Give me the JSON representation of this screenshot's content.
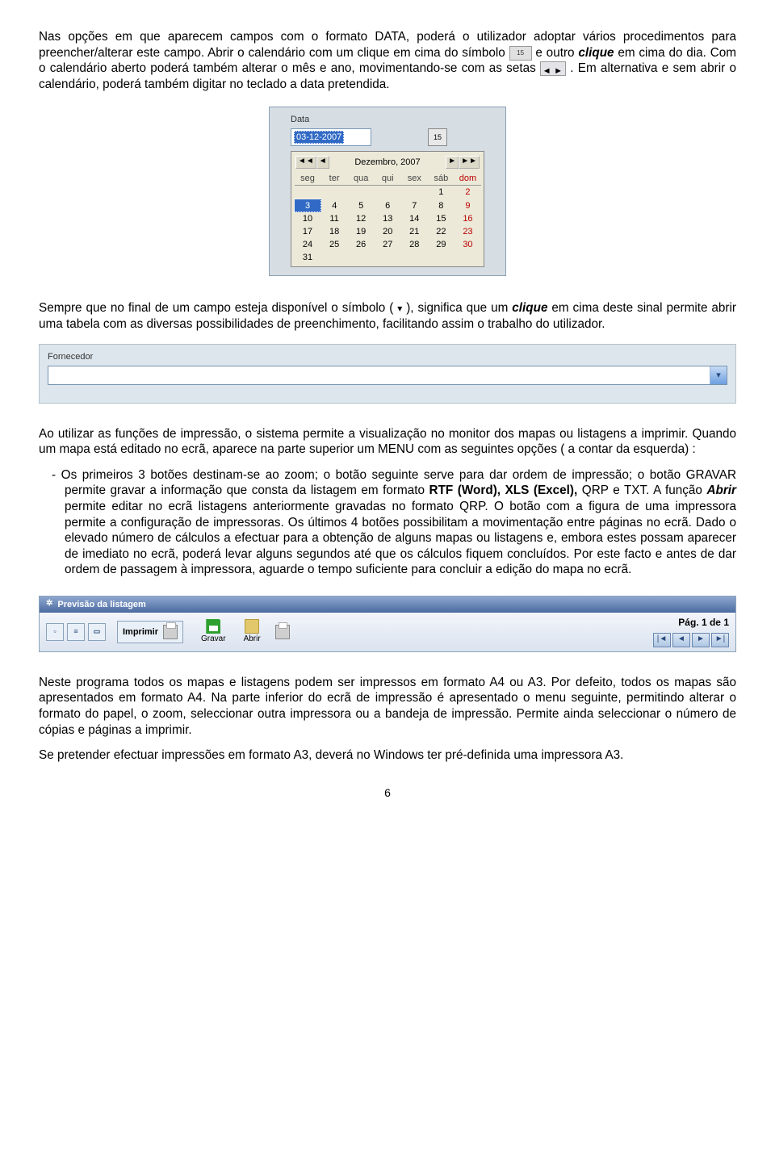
{
  "para1": {
    "t1": "Nas opções em que aparecem campos com o formato DATA, poderá o utilizador adoptar vários procedimentos para preencher/alterar este campo. Abrir o calendário com um clique em cima do símbolo ",
    "icon1_label": "15",
    "t2": " e outro ",
    "clique": "clique",
    "t3": " em cima do dia. Com o calendário aberto poderá também alterar o mês e ano, movimentando-se com as setas ",
    "t4": ". Em alternativa e sem abrir o calendário, poderá também digitar no teclado a data pretendida."
  },
  "calendar": {
    "label": "Data",
    "value": "03-12-2007",
    "popup_title": "Dezembro, 2007",
    "nav_prev2": "◄◄",
    "nav_prev1": "◄",
    "nav_next1": "►",
    "nav_next2": "►►",
    "dow": [
      "seg",
      "ter",
      "qua",
      "qui",
      "sex",
      "sáb",
      "dom"
    ],
    "cells": [
      [
        "",
        "",
        "",
        "",
        "",
        "1",
        "2"
      ],
      [
        "3",
        "4",
        "5",
        "6",
        "7",
        "8",
        "9"
      ],
      [
        "10",
        "11",
        "12",
        "13",
        "14",
        "15",
        "16"
      ],
      [
        "17",
        "18",
        "19",
        "20",
        "21",
        "22",
        "23"
      ],
      [
        "24",
        "25",
        "26",
        "27",
        "28",
        "29",
        "30"
      ],
      [
        "31",
        "",
        "",
        "",
        "",
        "",
        ""
      ]
    ],
    "selected": "3"
  },
  "para2": {
    "t1": "Sempre que no final de um campo esteja disponível o símbolo (",
    "t2": " ), significa que um ",
    "clique": "clique",
    "t3": " em cima deste sinal permite abrir uma tabela com as diversas possibilidades de preenchimento, facilitando assim o trabalho do utilizador."
  },
  "fornecedor": {
    "label": "Fornecedor"
  },
  "para3a": "Ao utilizar as funções de impressão, o sistema permite a visualização no monitor dos mapas ou listagens a imprimir. Quando um mapa está editado no ecrã, aparece na parte superior um MENU com as seguintes opções ( a contar da esquerda) :",
  "bullet": {
    "t1": "Os primeiros 3 botões destinam-se ao zoom; o botão seguinte serve para dar ordem de impressão; o botão GRAVAR permite gravar a informação que consta da listagem em formato ",
    "b1": "RTF (Word), XLS (Excel),",
    "t2": " QRP e TXT. A função ",
    "b2": "Abrir",
    "t3": " permite editar no ecrã listagens anteriormente gravadas no formato QRP. O botão com a figura de uma impressora permite a configuração de impressoras. Os últimos 4 botões possibilitam a movimentação entre páginas no ecrã. Dado o elevado número de cálculos a efectuar para a obtenção de alguns mapas ou listagens e, embora estes possam aparecer de imediato no ecrã, poderá levar alguns segundos até que os cálculos fiquem concluídos. Por este facto e antes de dar ordem de passagem à impressora, aguarde o tempo suficiente para concluir a edição do mapa no ecrã."
  },
  "toolbar": {
    "title": "Previsão da listagem",
    "zoom_whole": "▫",
    "zoom_width": "≡",
    "zoom_100": "▭",
    "print": "Imprimir",
    "save": "Gravar",
    "open": "Abrir",
    "pager": "Pág. 1 de 1",
    "nav_first": "|◄",
    "nav_prev": "◄",
    "nav_next": "►",
    "nav_last": "►|"
  },
  "para4a": "Neste programa todos os mapas e listagens podem ser impressos em formato A4 ou A3. Por defeito, todos os mapas são apresentados em formato A4. Na parte inferior do ecrã de impressão é apresentado o menu seguinte, permitindo alterar o formato do papel, o zoom, seleccionar outra impressora ou a bandeja de impressão. Permite ainda seleccionar o número de cópias e páginas a imprimir.",
  "para4b": "Se pretender efectuar impressões em formato A3, deverá no Windows ter pré-definida uma impressora A3.",
  "page_num": "6"
}
